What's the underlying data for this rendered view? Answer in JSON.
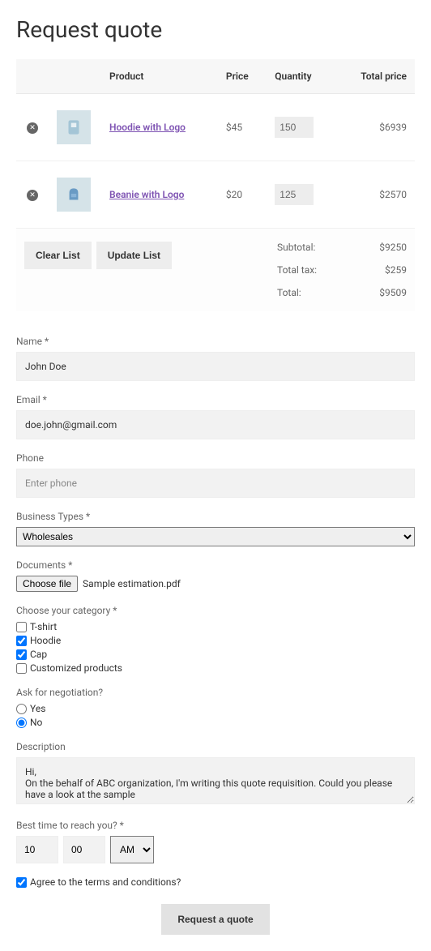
{
  "title": "Request quote",
  "table": {
    "headers": {
      "product": "Product",
      "price": "Price",
      "quantity": "Quantity",
      "total": "Total price"
    },
    "rows": [
      {
        "name": "Hoodie with Logo",
        "price": "$45",
        "qty": "150",
        "total": "$6939"
      },
      {
        "name": "Beanie with Logo",
        "price": "$20",
        "qty": "125",
        "total": "$2570"
      }
    ],
    "clear": "Clear List",
    "update": "Update List",
    "summary": {
      "subtotal": {
        "label": "Subtotal:",
        "value": "$9250"
      },
      "tax": {
        "label": "Total tax:",
        "value": "$259"
      },
      "total": {
        "label": "Total:",
        "value": "$9509"
      }
    }
  },
  "form": {
    "name": {
      "label": "Name *",
      "value": "John Doe"
    },
    "email": {
      "label": "Email *",
      "value": "doe.john@gmail.com"
    },
    "phone": {
      "label": "Phone",
      "placeholder": "Enter phone"
    },
    "business": {
      "label": "Business Types *",
      "value": "Wholesales"
    },
    "documents": {
      "label": "Documents *",
      "button": "Choose file",
      "file": "Sample estimation.pdf"
    },
    "category": {
      "label": "Choose your category *",
      "options": [
        {
          "label": "T-shirt",
          "checked": false
        },
        {
          "label": "Hoodie",
          "checked": true
        },
        {
          "label": "Cap",
          "checked": true
        },
        {
          "label": "Customized products",
          "checked": false
        }
      ]
    },
    "negotiation": {
      "label": "Ask for negotiation?",
      "options": [
        {
          "label": "Yes",
          "checked": false
        },
        {
          "label": "No",
          "checked": true
        }
      ]
    },
    "description": {
      "label": "Description",
      "value": "Hi,\nOn the behalf of ABC organization, I'm writing this quote requisition. Could you please have a look at the sample"
    },
    "time": {
      "label": "Best time to reach you? *",
      "hour": "10",
      "minute": "00",
      "period": "AM"
    },
    "terms": {
      "label": "Agree to the terms and conditions?",
      "checked": true
    },
    "submit": "Request a quote"
  }
}
